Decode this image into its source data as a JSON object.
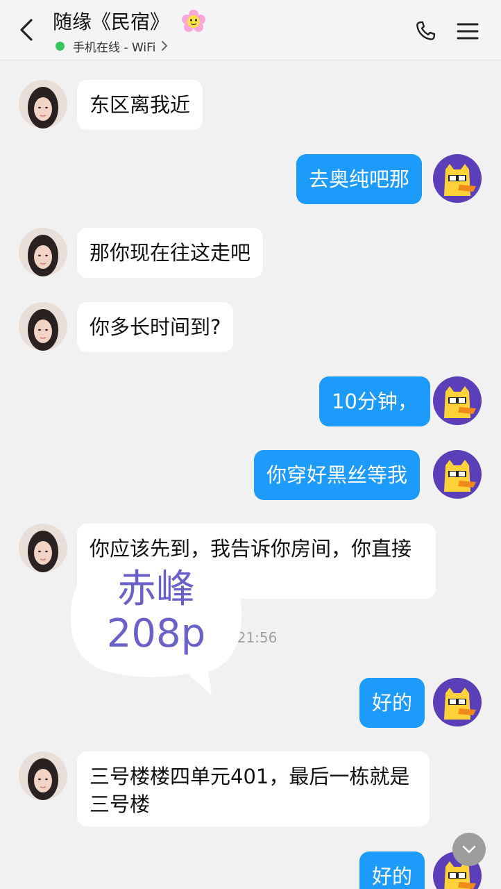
{
  "header": {
    "title": "随缘《民宿》",
    "status_text": "手机在线 - WiFi",
    "icons": {
      "back": "back-chevron-icon",
      "call": "phone-icon",
      "menu": "menu-icon",
      "emoji": "flower-emoji-icon",
      "status_chevron": "chevron-right-icon"
    }
  },
  "messages": [
    {
      "side": "left",
      "text": "东区离我近"
    },
    {
      "side": "right",
      "text": "去奥纯吧那"
    },
    {
      "side": "left",
      "text": "那你现在往这走吧"
    },
    {
      "side": "left",
      "text": "你多长时间到?"
    },
    {
      "side": "right",
      "text": "10分钟，"
    },
    {
      "side": "right",
      "text": "你穿好黑丝等我"
    },
    {
      "side": "left",
      "text": "你应该先到，我告诉你房间，你直接"
    },
    {
      "side": "right",
      "text": "好的"
    },
    {
      "side": "left",
      "text": "三号楼楼四单元401，最后一栋就是三号楼"
    },
    {
      "side": "right",
      "text": "好的"
    }
  ],
  "timestamp": "5 21:56",
  "watermark": {
    "line1": "赤峰",
    "line2": "208p"
  },
  "colors": {
    "sent_bubble": "#1c9bfb",
    "received_bubble": "#ffffff",
    "background": "#f1f1f1",
    "online": "#35c759",
    "watermark_text": "#6a62c8"
  }
}
